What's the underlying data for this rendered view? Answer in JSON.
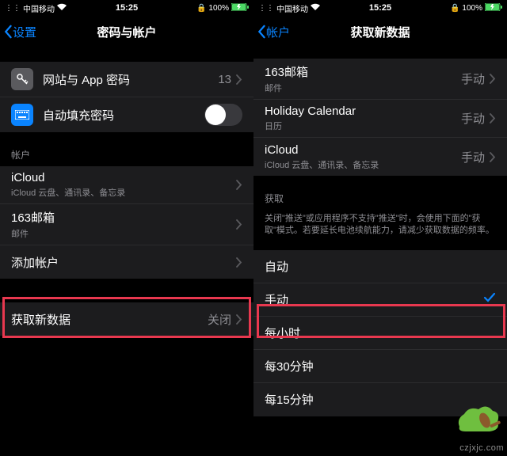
{
  "status": {
    "carrier": "中国移动",
    "time": "15:25",
    "battery": "100%"
  },
  "left": {
    "back": "设置",
    "title": "密码与帐户",
    "rows": {
      "webpw": {
        "label": "网站与 App 密码",
        "value": "13"
      },
      "autofill": {
        "label": "自动填充密码"
      }
    },
    "sectionAccounts": "帐户",
    "accounts": [
      {
        "label": "iCloud",
        "sub": "iCloud 云盘、通讯录、备忘录"
      },
      {
        "label": "163邮箱",
        "sub": "邮件"
      }
    ],
    "addAccount": "添加帐户",
    "fetch": {
      "label": "获取新数据",
      "value": "关闭"
    }
  },
  "right": {
    "back": "帐户",
    "title": "获取新数据",
    "accounts": [
      {
        "label": "163邮箱",
        "sub": "邮件",
        "value": "手动"
      },
      {
        "label": "Holiday Calendar",
        "sub": "日历",
        "value": "手动"
      },
      {
        "label": "iCloud",
        "sub": "iCloud 云盘、通讯录、备忘录",
        "value": "手动"
      }
    ],
    "sectionFetch": "获取",
    "fetchNote": "关闭\"推送\"或应用程序不支持\"推送\"时，会使用下面的\"获取\"模式。若要延长电池续航能力，请减少获取数据的频率。",
    "options": [
      "自动",
      "手动",
      "每小时",
      "每30分钟",
      "每15分钟"
    ],
    "selectedIndex": 1
  },
  "watermark": "czjxjc.com"
}
